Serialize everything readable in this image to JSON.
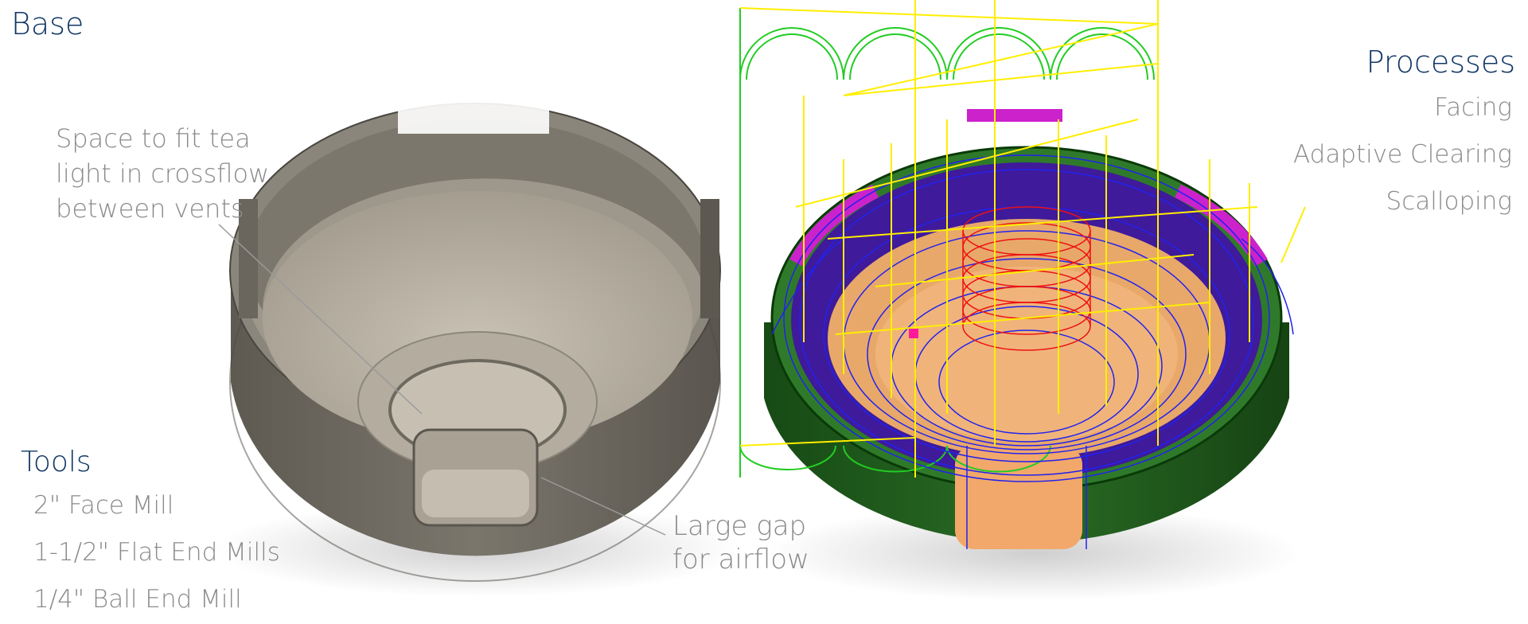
{
  "title": "Base",
  "callouts": {
    "tea_light": "Space to fit tea light in crossflow between vents",
    "airflow_line1": "Large gap",
    "airflow_line2": "for airflow"
  },
  "tools": {
    "heading": "Tools",
    "items": [
      "2\" Face Mill",
      "1-1/2\" Flat End Mills",
      "1/4\" Ball End Mill"
    ]
  },
  "processes": {
    "heading": "Processes",
    "items": [
      "Facing",
      "Adaptive Clearing",
      "Scalloping"
    ]
  },
  "colors": {
    "heading": "#123766",
    "label": "#8a8a8a",
    "model_body": "#6f6b62",
    "model_interior": "#bdb6a8",
    "cam_body": "#1f5a1c",
    "toolpath_yellow": "#ffee00",
    "toolpath_blue": "#2222ee",
    "toolpath_green": "#22cc22",
    "toolpath_red": "#ee1111",
    "toolpath_magenta": "#cc22cc",
    "stock_orange": "#f2a86a"
  }
}
